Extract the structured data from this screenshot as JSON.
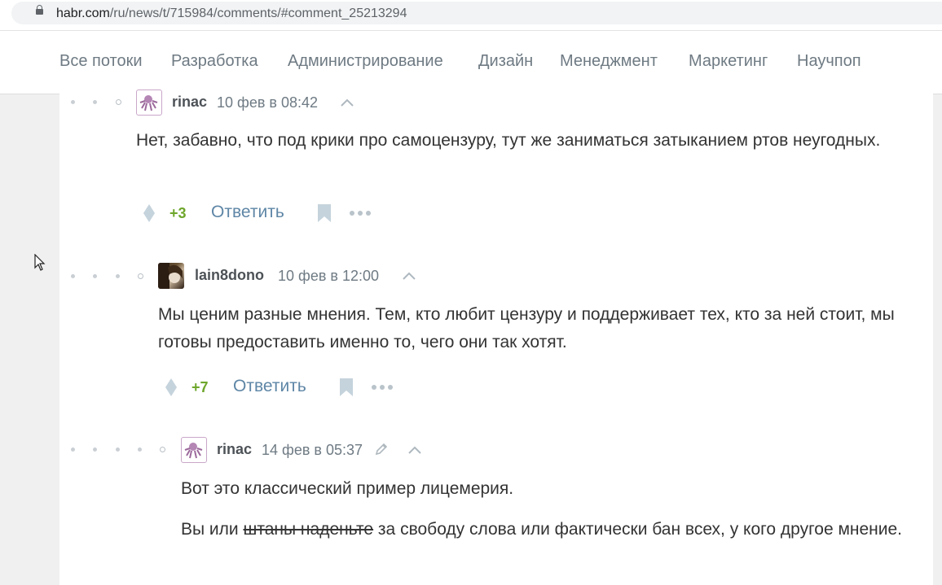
{
  "browser": {
    "url_host": "habr.com",
    "url_path": "/ru/news/t/715984/comments/#comment_25213294"
  },
  "nav": {
    "items": [
      "Все потоки",
      "Разработка",
      "Администрирование",
      "Дизайн",
      "Менеджмент",
      "Маркетинг",
      "Научпоп"
    ]
  },
  "comments": [
    {
      "author": "rinac",
      "date": "10 фев в 08:42",
      "paragraphs": [
        "Нет, забавно, что под крики про самоцензуру, тут же заниматься затыканием ртов неугодных."
      ],
      "score": "+3",
      "reply": "Ответить"
    },
    {
      "author": "lain8dono",
      "date": "10 фев в 12:00",
      "paragraphs": [
        "Мы ценим разные мнения. Тем, кто любит цензуру и поддерживает тех, кто за ней стоит, мы готовы предоставить именно то, чего они так хотят."
      ],
      "score": "+7",
      "reply": "Ответить"
    },
    {
      "author": "rinac",
      "date": "14 фев в 05:37",
      "paragraphs": [
        "Вот это классический пример лицемерия."
      ],
      "p2_before": "Вы или ",
      "p2_strike": "штаны наденьте",
      "p2_after": " за свободу слова или фактически бан всех, у кого другое мнение."
    }
  ],
  "icons": {
    "upvote": "diamond-vote-icon",
    "bookmark": "bookmark-icon",
    "more": "more-dots-icon",
    "edit": "pencil-icon",
    "collapse": "chevron-up-icon"
  }
}
